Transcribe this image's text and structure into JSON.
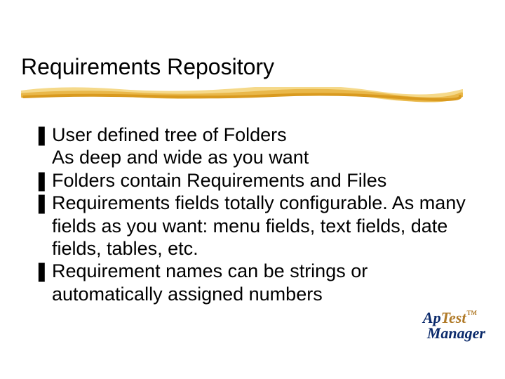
{
  "title": "Requirements Repository",
  "bullet_glyph": "❚",
  "bullets": [
    "User defined tree of Folders\nAs deep and wide as you want",
    "Folders contain Requirements and Files",
    "Requirements fields totally configurable. As many fields as you want: menu fields, text fields, date fields, tables, etc.",
    "Requirement names can be strings or automatically assigned numbers"
  ],
  "logo": {
    "part1": "Ap",
    "part2": "Test",
    "part3": "Manager",
    "tm": "TM"
  },
  "colors": {
    "underline_light": "#f5d98a",
    "underline_mid": "#e9b84a",
    "underline_dark": "#d99a1f"
  }
}
